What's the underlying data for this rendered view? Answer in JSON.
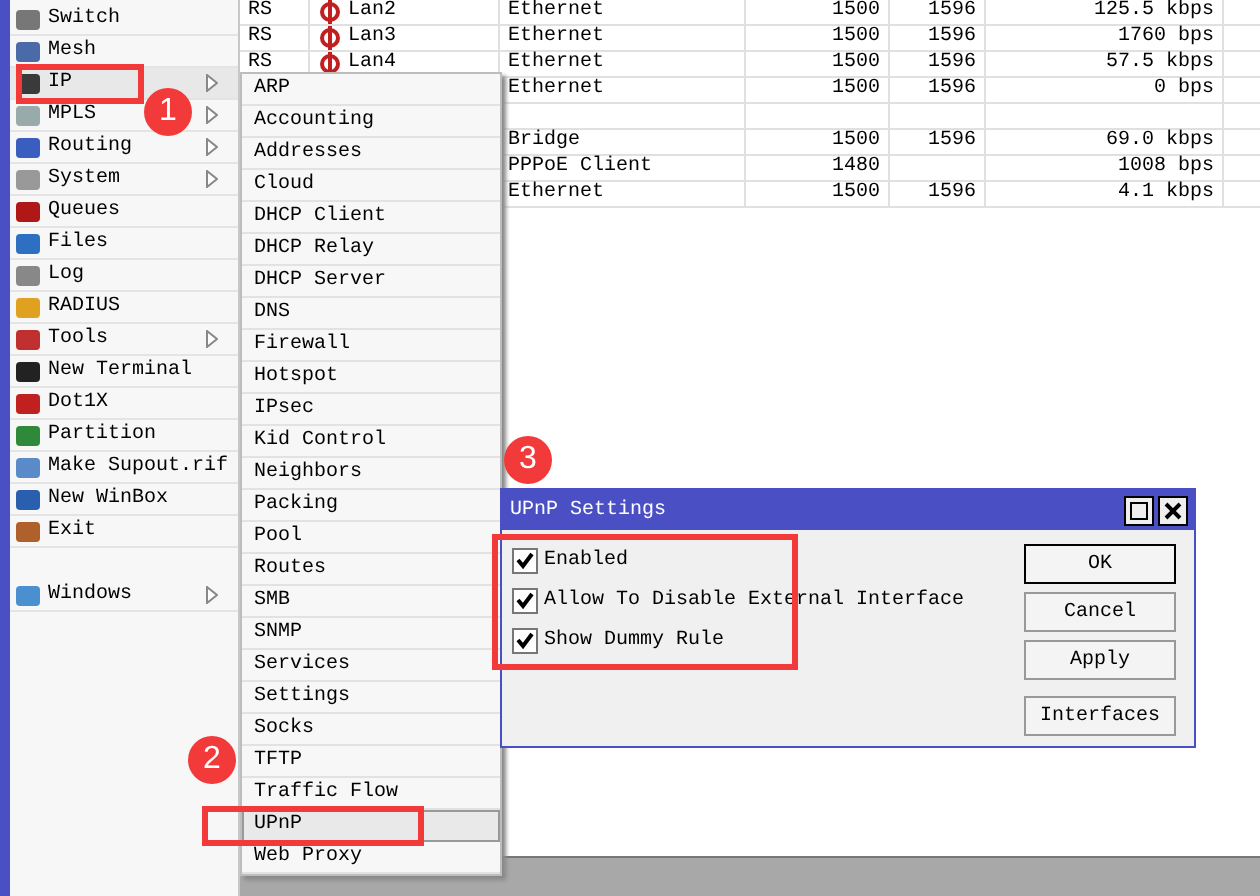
{
  "sidebar": {
    "items": [
      {
        "label": "Switch",
        "selected": false,
        "has_submenu": false
      },
      {
        "label": "Mesh",
        "selected": false,
        "has_submenu": false
      },
      {
        "label": "IP",
        "selected": true,
        "has_submenu": true
      },
      {
        "label": "MPLS",
        "selected": false,
        "has_submenu": true
      },
      {
        "label": "Routing",
        "selected": false,
        "has_submenu": true
      },
      {
        "label": "System",
        "selected": false,
        "has_submenu": true
      },
      {
        "label": "Queues",
        "selected": false,
        "has_submenu": false
      },
      {
        "label": "Files",
        "selected": false,
        "has_submenu": false
      },
      {
        "label": "Log",
        "selected": false,
        "has_submenu": false
      },
      {
        "label": "RADIUS",
        "selected": false,
        "has_submenu": false
      },
      {
        "label": "Tools",
        "selected": false,
        "has_submenu": true
      },
      {
        "label": "New Terminal",
        "selected": false,
        "has_submenu": false
      },
      {
        "label": "Dot1X",
        "selected": false,
        "has_submenu": false
      },
      {
        "label": "Partition",
        "selected": false,
        "has_submenu": false
      },
      {
        "label": "Make Supout.rif",
        "selected": false,
        "has_submenu": false
      },
      {
        "label": "New WinBox",
        "selected": false,
        "has_submenu": false
      },
      {
        "label": "Exit",
        "selected": false,
        "has_submenu": false
      },
      {
        "label": "Windows",
        "selected": false,
        "has_submenu": true
      }
    ]
  },
  "table": {
    "rows": [
      {
        "flags": "RS",
        "name": "Lan2",
        "type": "Ethernet",
        "mtu": "1500",
        "l2mtu": "1596",
        "tx": "125.5 kbps"
      },
      {
        "flags": "RS",
        "name": "Lan3",
        "type": "Ethernet",
        "mtu": "1500",
        "l2mtu": "1596",
        "tx": "1760 bps"
      },
      {
        "flags": "RS",
        "name": "Lan4",
        "type": "Ethernet",
        "mtu": "1500",
        "l2mtu": "1596",
        "tx": "57.5 kbps"
      },
      {
        "type": "Ethernet",
        "mtu": "1500",
        "l2mtu": "1596",
        "tx": "0 bps"
      },
      {},
      {
        "type": "Bridge",
        "mtu": "1500",
        "l2mtu": "1596",
        "tx": "69.0 kbps"
      },
      {
        "type": "PPPoE Client",
        "mtu": "1480",
        "tx": "1008 bps"
      },
      {
        "type": "Ethernet",
        "mtu": "1500",
        "l2mtu": "1596",
        "tx": "4.1 kbps"
      }
    ]
  },
  "submenu": {
    "items": [
      {
        "label": "ARP",
        "selected": false
      },
      {
        "label": "Accounting",
        "selected": false
      },
      {
        "label": "Addresses",
        "selected": false
      },
      {
        "label": "Cloud",
        "selected": false
      },
      {
        "label": "DHCP Client",
        "selected": false
      },
      {
        "label": "DHCP Relay",
        "selected": false
      },
      {
        "label": "DHCP Server",
        "selected": false
      },
      {
        "label": "DNS",
        "selected": false
      },
      {
        "label": "Firewall",
        "selected": false
      },
      {
        "label": "Hotspot",
        "selected": false
      },
      {
        "label": "IPsec",
        "selected": false
      },
      {
        "label": "Kid Control",
        "selected": false
      },
      {
        "label": "Neighbors",
        "selected": false
      },
      {
        "label": "Packing",
        "selected": false
      },
      {
        "label": "Pool",
        "selected": false
      },
      {
        "label": "Routes",
        "selected": false
      },
      {
        "label": "SMB",
        "selected": false
      },
      {
        "label": "SNMP",
        "selected": false
      },
      {
        "label": "Services",
        "selected": false
      },
      {
        "label": "Settings",
        "selected": false
      },
      {
        "label": "Socks",
        "selected": false
      },
      {
        "label": "TFTP",
        "selected": false
      },
      {
        "label": "Traffic Flow",
        "selected": false
      },
      {
        "label": "UPnP",
        "selected": true
      },
      {
        "label": "Web Proxy",
        "selected": false
      }
    ]
  },
  "dialog": {
    "title": "UPnP Settings",
    "options": [
      {
        "label": "Enabled",
        "checked": true
      },
      {
        "label": "Allow To Disable External Interface",
        "checked": true
      },
      {
        "label": "Show Dummy Rule",
        "checked": true
      }
    ],
    "buttons": [
      {
        "label": "OK",
        "default": true
      },
      {
        "label": "Cancel",
        "default": false
      },
      {
        "label": "Apply",
        "default": false
      },
      {
        "label": "Interfaces",
        "default": false
      }
    ]
  },
  "annotations": {
    "badges": [
      "1",
      "2",
      "3"
    ]
  }
}
